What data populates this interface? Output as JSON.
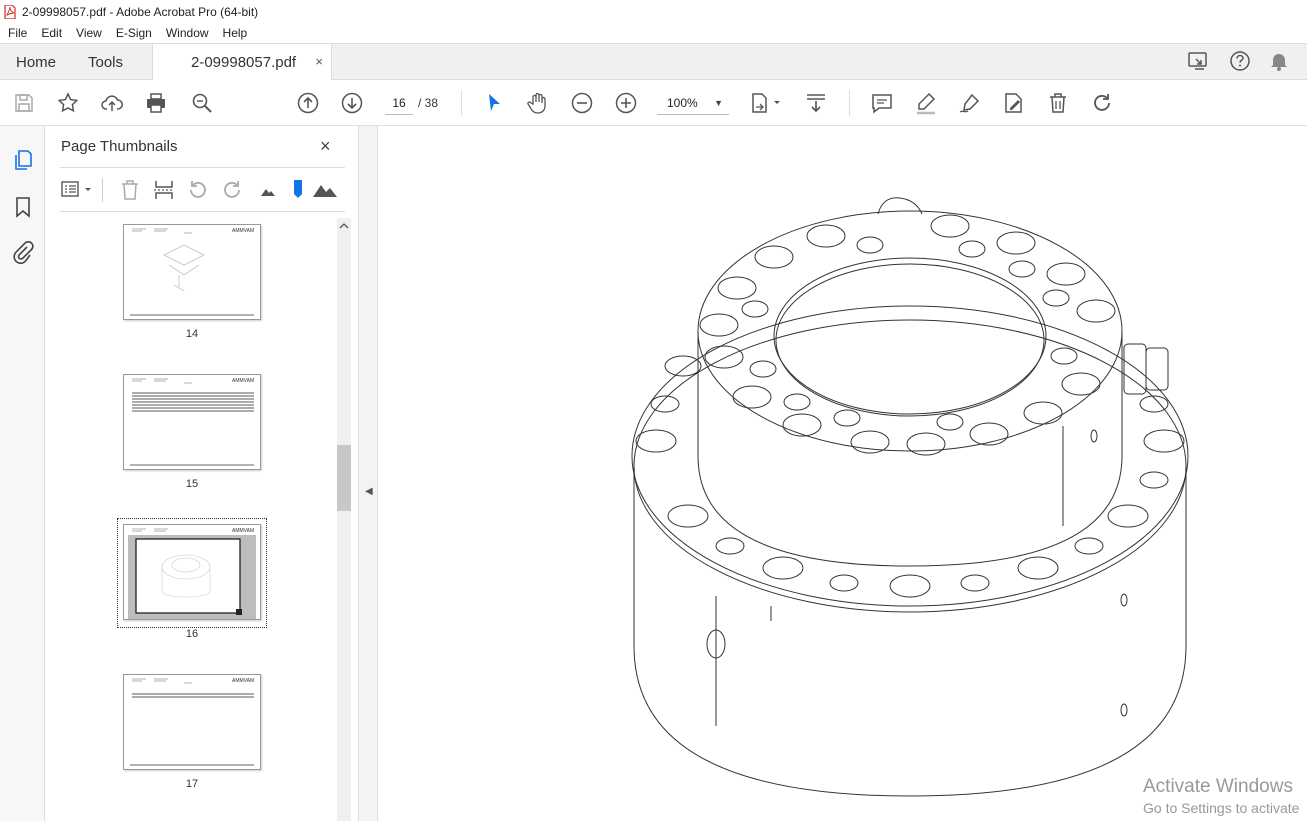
{
  "window": {
    "title": "2-09998057.pdf - Adobe Acrobat Pro (64-bit)"
  },
  "menu": {
    "items": [
      "File",
      "Edit",
      "View",
      "E-Sign",
      "Window",
      "Help"
    ]
  },
  "tabs": {
    "home": "Home",
    "tools": "Tools",
    "document": "2-09998057.pdf",
    "close_glyph": "×"
  },
  "toolbar": {
    "current_page": "16",
    "page_total": "/ 38",
    "zoom": "100%"
  },
  "panel": {
    "title": "Page Thumbnails",
    "close_glyph": "×",
    "thumbnails": [
      {
        "page": "14",
        "header_tag": "AMMVAM",
        "selected": false
      },
      {
        "page": "15",
        "header_tag": "AMMVAM",
        "selected": false
      },
      {
        "page": "16",
        "header_tag": "AMMVAM",
        "selected": true
      },
      {
        "page": "17",
        "header_tag": "AMMVAM",
        "selected": false
      }
    ]
  },
  "watermark": {
    "line1": "Activate Windows",
    "line2": "Go to Settings to activate"
  },
  "colors": {
    "accent": "#1473e6",
    "chrome": "#f0f0f0"
  }
}
